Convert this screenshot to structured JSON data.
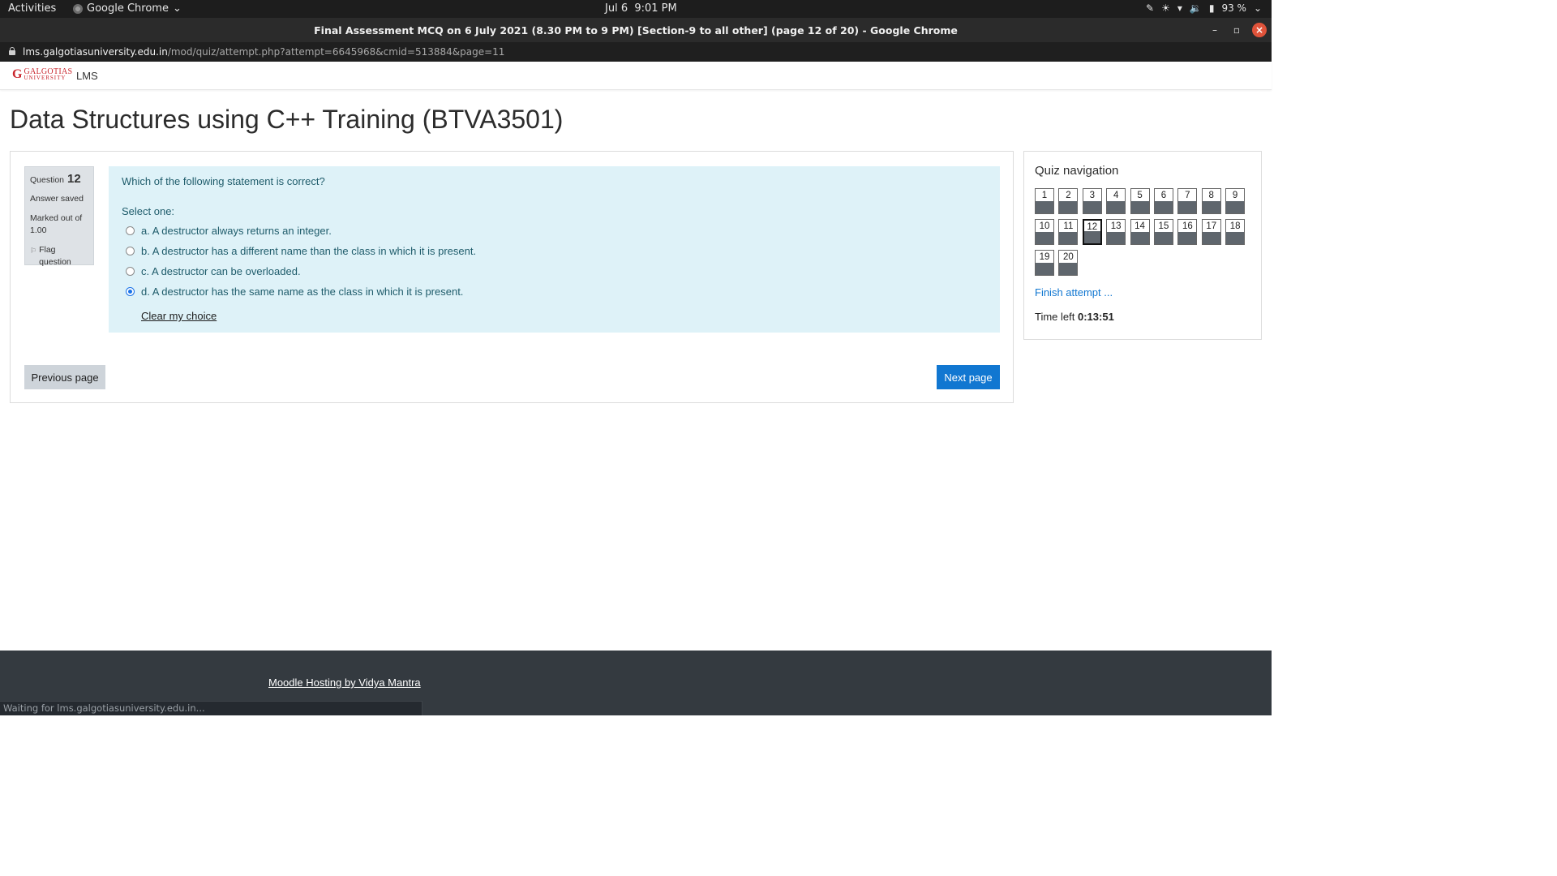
{
  "os_bar": {
    "activities": "Activities",
    "app_name": "Google Chrome",
    "date": "Jul 6",
    "time": "9:01 PM",
    "battery": "93 %"
  },
  "window": {
    "title": "Final Assessment MCQ on 6 July 2021 (8.30 PM to 9 PM) [Section-9 to all other] (page 12 of 20) - Google Chrome"
  },
  "address": {
    "host": "lms.galgotiasuniversity.edu.in",
    "path": "/mod/quiz/attempt.php?attempt=6645968&cmid=513884&page=11"
  },
  "site": {
    "logo_word1": "GALGOTIAS",
    "logo_word2": "UNIVERSITY",
    "name": "LMS"
  },
  "course_title": "Data Structures using C++ Training (BTVA3501)",
  "question": {
    "label": "Question",
    "number": "12",
    "state": "Answer saved",
    "marked_out_of": "Marked out of 1.00",
    "flag_label": "Flag question",
    "text": "Which of the following statement is correct?",
    "prompt": "Select one:",
    "options": [
      {
        "label": "a. A destructor always returns an integer.",
        "selected": false
      },
      {
        "label": "b. A destructor has a different name than the class in which it is present.",
        "selected": false
      },
      {
        "label": "c. A destructor can be overloaded.",
        "selected": false
      },
      {
        "label": "d. A destructor has the same name as the class in which it is present.",
        "selected": true
      }
    ],
    "clear_label": "Clear my choice"
  },
  "nav_buttons": {
    "previous": "Previous page",
    "next": "Next page"
  },
  "quiz_nav": {
    "title": "Quiz navigation",
    "questions": [
      "1",
      "2",
      "3",
      "4",
      "5",
      "6",
      "7",
      "8",
      "9",
      "10",
      "11",
      "12",
      "13",
      "14",
      "15",
      "16",
      "17",
      "18",
      "19",
      "20"
    ],
    "current": "12",
    "finish": "Finish attempt ...",
    "time_label": "Time left",
    "time_value": "0:13:51"
  },
  "footer": {
    "hosting": "Moodle Hosting by Vidya Mantra"
  },
  "status": "Waiting for lms.galgotiasuniversity.edu.in..."
}
